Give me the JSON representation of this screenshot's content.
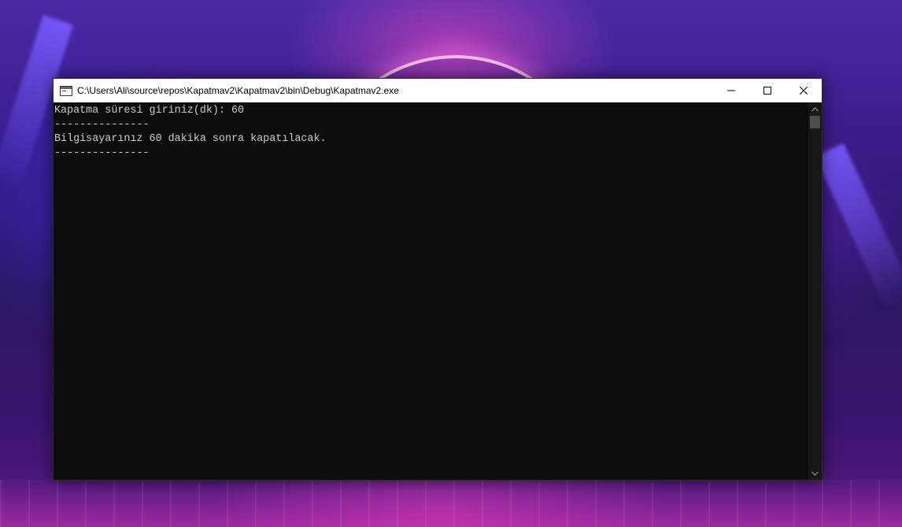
{
  "window": {
    "title": "C:\\Users\\Ali\\source\\repos\\Kapatmav2\\Kapatmav2\\bin\\Debug\\Kapatmav2.exe",
    "icon": "console-app-icon",
    "controls": {
      "minimize": "minimize-icon",
      "maximize": "maximize-icon",
      "close": "close-icon"
    }
  },
  "console": {
    "lines": [
      "Kapatma süresi giriniz(dk): 60",
      "---------------",
      "Bilgisayarınız 60 dakika sonra kapatılacak.",
      "---------------"
    ],
    "text_color": "#cccccc",
    "background": "#0c0c0c"
  }
}
